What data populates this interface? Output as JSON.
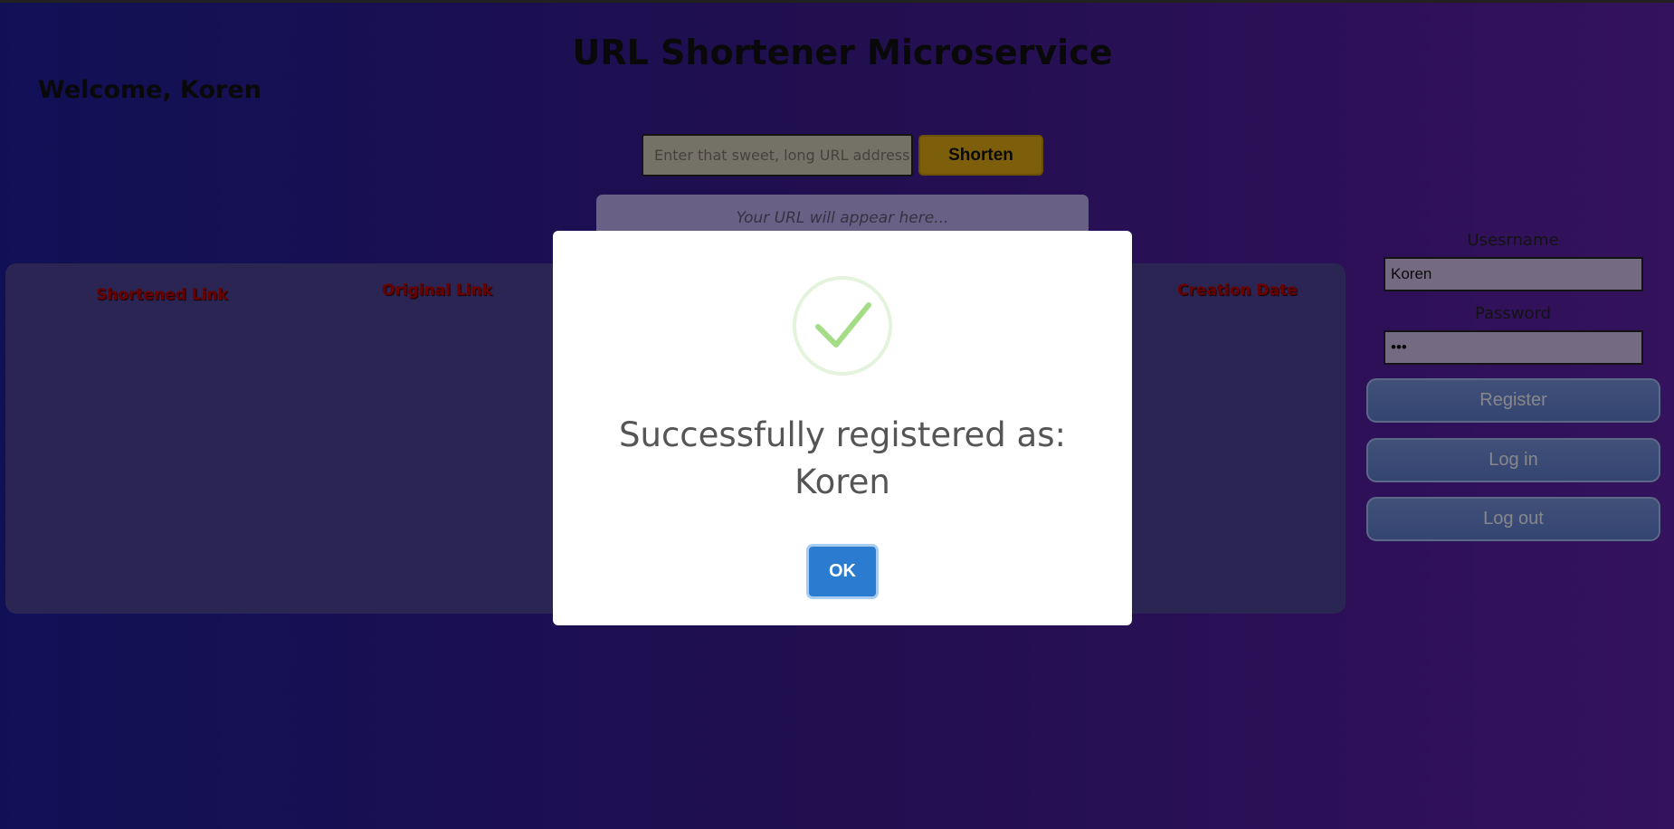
{
  "header": {
    "title": "URL Shortener Microservice",
    "welcome": "Welcome, Koren"
  },
  "shortener": {
    "url_placeholder": "Enter that sweet, long URL address",
    "shorten_label": "Shorten",
    "result_placeholder": "Your URL will appear here..."
  },
  "table": {
    "columns": [
      "Shortened Link",
      "Original Link",
      "Creation Date"
    ]
  },
  "auth": {
    "username_label": "Usesrname",
    "username_value": "Koren",
    "password_label": "Password",
    "password_value": "•••",
    "register_label": "Register",
    "login_label": "Log in",
    "logout_label": "Log out"
  },
  "modal": {
    "icon": "success-check-icon",
    "message_line1": "Successfully registered as:",
    "message_line2": "Koren",
    "ok_label": "OK"
  },
  "colors": {
    "gradient_start": "#1e1c94",
    "gradient_end": "#5a1fa0",
    "shorten_button": "#d7a313",
    "ok_button": "#2b7bd0",
    "table_header_text": "#b30000",
    "success_check": "#a5dc86"
  }
}
